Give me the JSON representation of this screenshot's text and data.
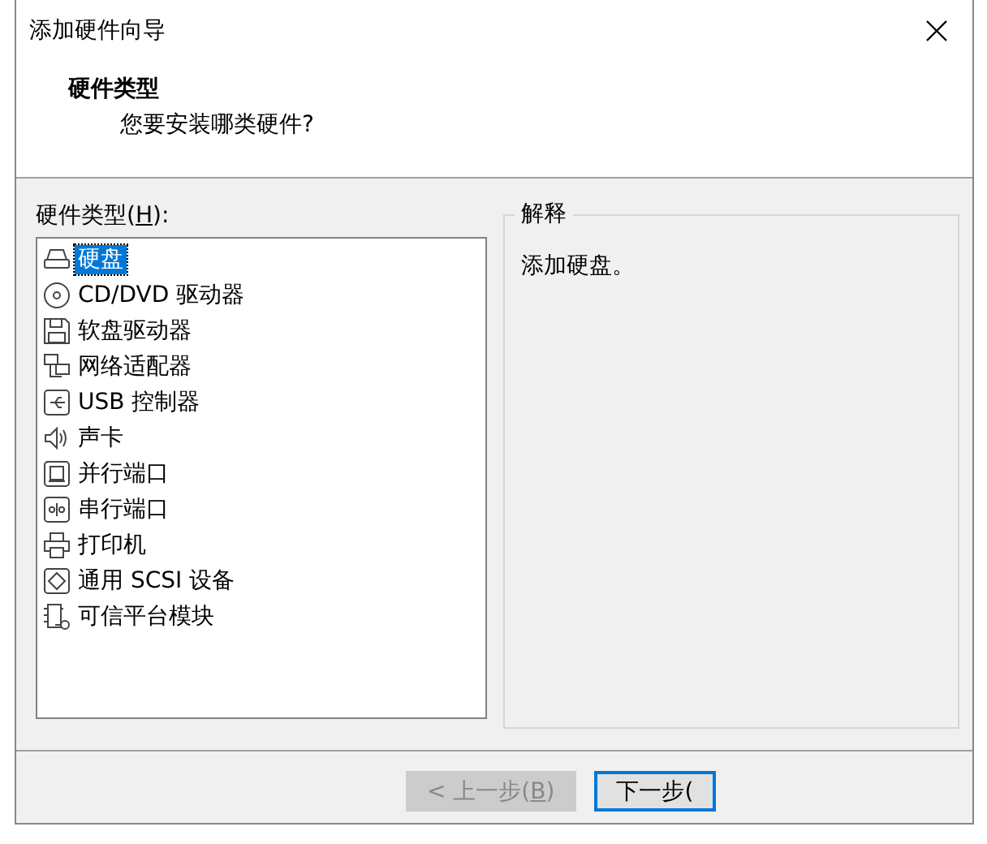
{
  "window": {
    "title": "添加硬件向导"
  },
  "header": {
    "title": "硬件类型",
    "subtitle": "您要安装哪类硬件?"
  },
  "hardware_list": {
    "label": {
      "before": "硬件类型(",
      "key": "H",
      "after": "):"
    },
    "items": [
      {
        "label": "硬盘",
        "selected": true
      },
      {
        "label": "CD/DVD 驱动器",
        "selected": false
      },
      {
        "label": "软盘驱动器",
        "selected": false
      },
      {
        "label": "网络适配器",
        "selected": false
      },
      {
        "label": "USB 控制器",
        "selected": false
      },
      {
        "label": "声卡",
        "selected": false
      },
      {
        "label": "并行端口",
        "selected": false
      },
      {
        "label": "串行端口",
        "selected": false
      },
      {
        "label": "打印机",
        "selected": false
      },
      {
        "label": "通用 SCSI 设备",
        "selected": false
      },
      {
        "label": "可信平台模块",
        "selected": false
      }
    ]
  },
  "explanation": {
    "title": "解释",
    "text": "添加硬盘。"
  },
  "buttons": [
    {
      "before": "< 上一步(",
      "key": "B",
      "after": ")",
      "disabled": true,
      "default": false
    },
    {
      "before": "下一步(",
      "disabled": false,
      "default": true
    }
  ]
}
